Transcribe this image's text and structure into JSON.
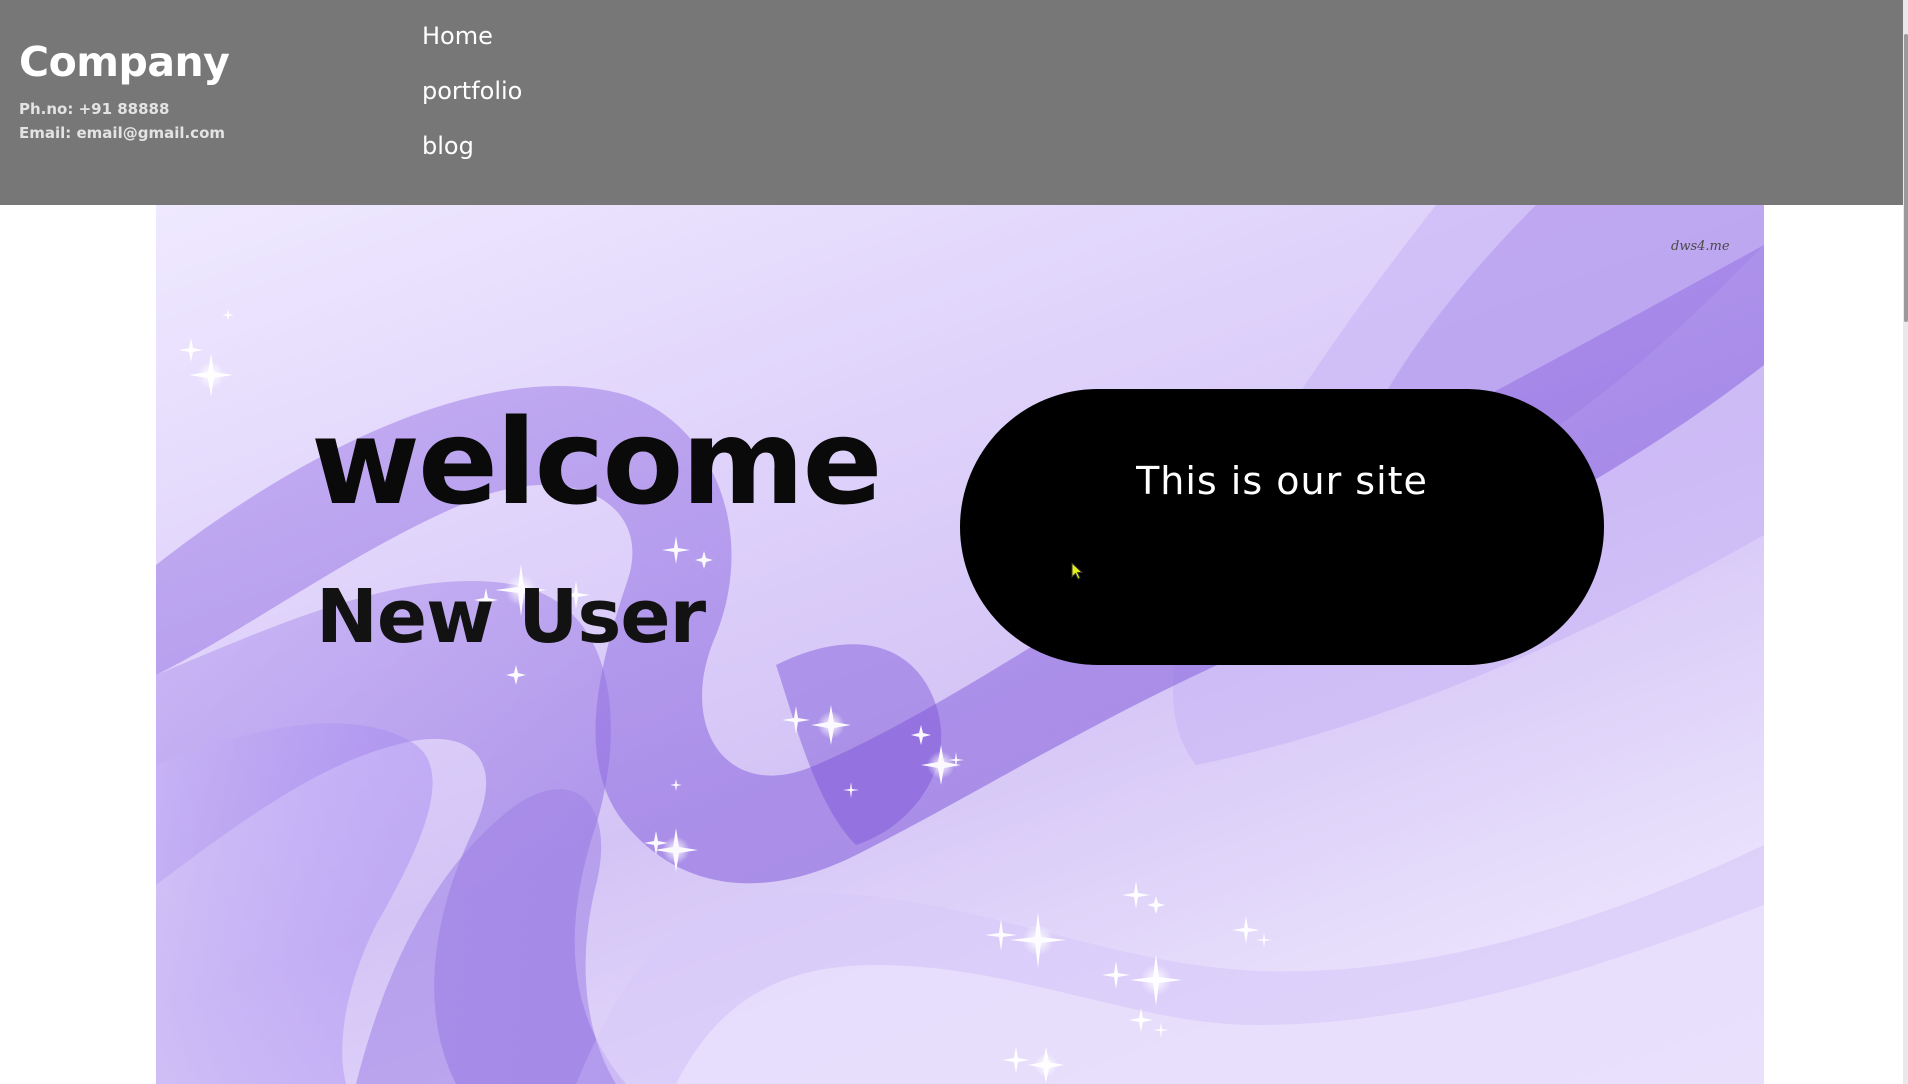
{
  "header": {
    "company_name": "Company",
    "phone": "Ph.no: +91 88888",
    "email": "Email: email@gmail.com",
    "nav": {
      "home": "Home",
      "portfolio": "portfolio",
      "blog": "blog"
    }
  },
  "hero": {
    "watermark": "dws4.me",
    "title": "welcome",
    "subtitle": "New User",
    "tagline": "This is our site"
  },
  "colors": {
    "header_bg": "#777777",
    "header_text": "#ffffff",
    "pill_bg": "#000000",
    "hero_accent": "#8e6fe0"
  },
  "icons": {
    "cursor": "mouse-pointer-icon"
  }
}
